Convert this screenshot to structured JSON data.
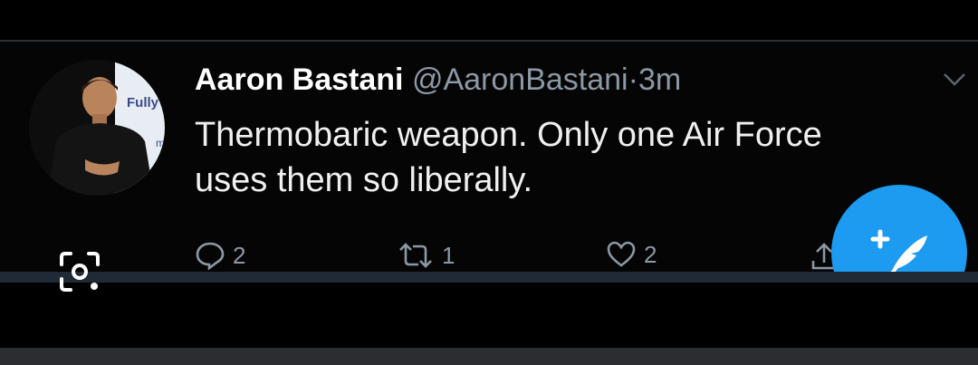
{
  "tweet": {
    "author_name": "Aaron Bastani",
    "handle": "@AaronBastani",
    "separator": "·",
    "time": "3m",
    "text_line1": "Thermobaric weapon. Only one Air Force",
    "text_line2": "uses them so liberally.",
    "avatar_text": "Fully",
    "avatar_text2": "m",
    "actions": {
      "reply_count": "2",
      "retweet_count": "1",
      "like_count": "2"
    }
  },
  "icons": {
    "avatar": "profile-photo",
    "caret": "chevron-down-icon",
    "reply": "reply-icon",
    "retweet": "retweet-icon",
    "like": "heart-icon",
    "share": "share-icon",
    "compose": "compose-tweet-icon",
    "lens": "lens-search-icon"
  },
  "colors": {
    "accent": "#1d9bf0",
    "muted": "#8b98a5",
    "background": "#000000"
  }
}
